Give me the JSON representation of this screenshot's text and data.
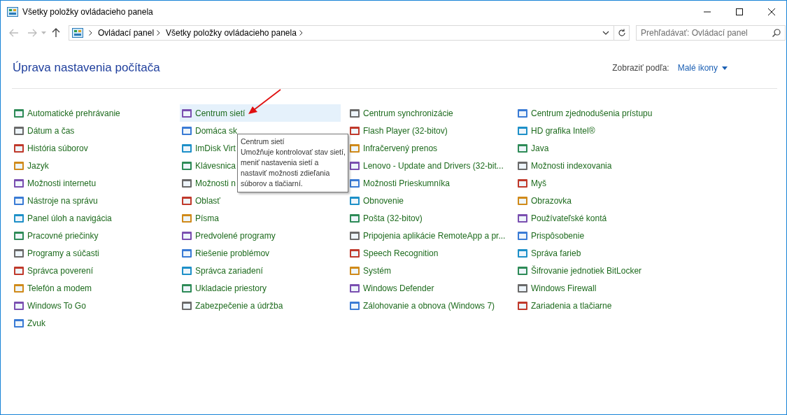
{
  "window": {
    "title": "Všetky položky ovládacieho panela"
  },
  "address_bar": {
    "breadcrumbs": [
      "Ovládací panel",
      "Všetky položky ovládacieho panela"
    ],
    "search": {
      "placeholder": "Prehľadávať: Ovládací panel"
    }
  },
  "header": {
    "title": "Úprava nastavenia počítača",
    "view_label": "Zobraziť podľa:",
    "view_value": "Malé ikony"
  },
  "columns": [
    {
      "items": [
        {
          "label": "Automatické prehrávanie",
          "selected": false
        },
        {
          "label": "Dátum a čas",
          "selected": false
        },
        {
          "label": "História súborov",
          "selected": false
        },
        {
          "label": "Jazyk",
          "selected": false
        },
        {
          "label": "Možnosti internetu",
          "selected": false
        },
        {
          "label": "Nástroje na správu",
          "selected": false
        },
        {
          "label": "Panel úloh a navigácia",
          "selected": false
        },
        {
          "label": "Pracovné priečinky",
          "selected": false
        },
        {
          "label": "Programy a súčasti",
          "selected": false
        },
        {
          "label": "Správca poverení",
          "selected": false
        },
        {
          "label": "Telefón a modem",
          "selected": false
        },
        {
          "label": "Windows To Go",
          "selected": false
        },
        {
          "label": "Zvuk",
          "selected": false
        }
      ]
    },
    {
      "items": [
        {
          "label": "Centrum sietí",
          "selected": true
        },
        {
          "label": "Domáca sk",
          "selected": false
        },
        {
          "label": "ImDisk Virt",
          "selected": false
        },
        {
          "label": "Klávesnica",
          "selected": false
        },
        {
          "label": "Možnosti n",
          "selected": false
        },
        {
          "label": "Oblasť",
          "selected": false
        },
        {
          "label": "Písma",
          "selected": false
        },
        {
          "label": "Predvolené programy",
          "selected": false
        },
        {
          "label": "Riešenie problémov",
          "selected": false
        },
        {
          "label": "Správca zariadení",
          "selected": false
        },
        {
          "label": "Ukladacie priestory",
          "selected": false
        },
        {
          "label": "Zabezpečenie a údržba",
          "selected": false
        }
      ]
    },
    {
      "items": [
        {
          "label": "Centrum synchronizácie",
          "selected": false
        },
        {
          "label": "Flash Player (32-bitov)",
          "selected": false
        },
        {
          "label": "Infračervený prenos",
          "selected": false
        },
        {
          "label": "Lenovo - Update and Drivers (32-bit...",
          "selected": false
        },
        {
          "label": "Možnosti Prieskumníka",
          "selected": false
        },
        {
          "label": "Obnovenie",
          "selected": false
        },
        {
          "label": "Pošta (32-bitov)",
          "selected": false
        },
        {
          "label": "Pripojenia aplikácie RemoteApp a pr...",
          "selected": false
        },
        {
          "label": "Speech Recognition",
          "selected": false
        },
        {
          "label": "Systém",
          "selected": false
        },
        {
          "label": "Windows Defender",
          "selected": false
        },
        {
          "label": "Zálohovanie a obnova (Windows 7)",
          "selected": false
        }
      ]
    },
    {
      "items": [
        {
          "label": "Centrum zjednodušenia prístupu",
          "selected": false
        },
        {
          "label": "HD grafika Intel®",
          "selected": false
        },
        {
          "label": "Java",
          "selected": false
        },
        {
          "label": "Možnosti indexovania",
          "selected": false
        },
        {
          "label": "Myš",
          "selected": false
        },
        {
          "label": "Obrazovka",
          "selected": false
        },
        {
          "label": "Používateľské kontá",
          "selected": false
        },
        {
          "label": "Prispôsobenie",
          "selected": false
        },
        {
          "label": "Správa farieb",
          "selected": false
        },
        {
          "label": "Šifrovanie jednotiek BitLocker",
          "selected": false
        },
        {
          "label": "Windows Firewall",
          "selected": false
        },
        {
          "label": "Zariadenia a tlačiarne",
          "selected": false
        }
      ]
    }
  ],
  "tooltip": {
    "title": "Centrum sietí",
    "text": "Umožňuje kontrolovať stav sietí, meniť nastavenia sietí a nastaviť možnosti zdieľania súborov a tlačiarní."
  }
}
